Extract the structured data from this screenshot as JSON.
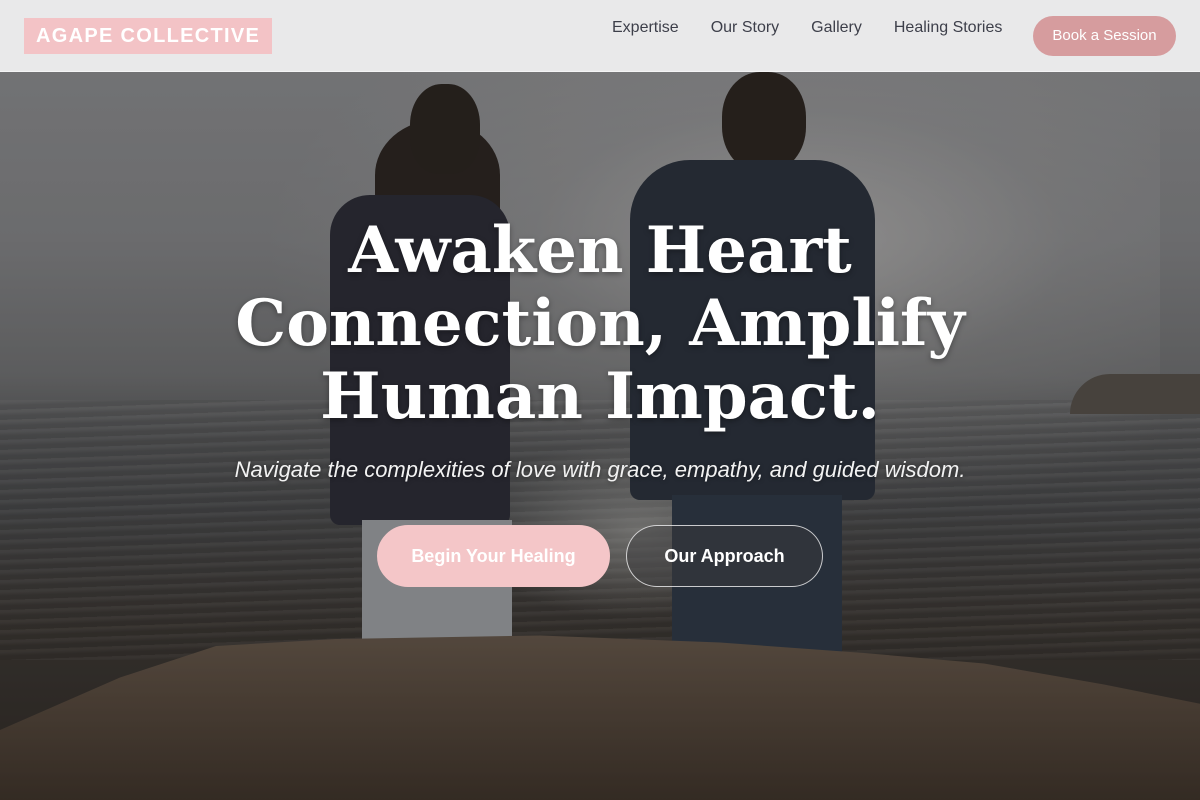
{
  "brand": {
    "logo_text": "AGAPE COLLECTIVE",
    "accent_color": "#f3c3c6",
    "button_color": "#d69c9e"
  },
  "nav": {
    "items": [
      {
        "label": "Expertise"
      },
      {
        "label": "Our Story"
      },
      {
        "label": "Gallery"
      },
      {
        "label": "Healing Stories"
      }
    ],
    "cta_label": "Book a Session"
  },
  "hero": {
    "headline_lines": [
      "Awaken Heart",
      "Connection, Amplify",
      "Human Impact."
    ],
    "subtitle": "Navigate the complexities of love with grace, empathy, and guided wisdom.",
    "primary_cta": "Begin Your Healing",
    "secondary_cta": "Our Approach"
  }
}
